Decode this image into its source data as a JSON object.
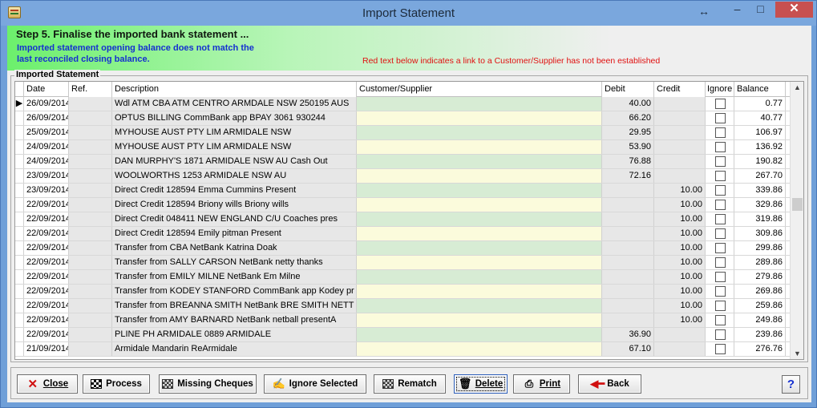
{
  "window": {
    "title": "Import Statement"
  },
  "header": {
    "step": "Step 5. Finalise the imported bank statement ...",
    "warning_line1": "Imported statement opening balance does not match the",
    "warning_line2": "last reconciled closing balance.",
    "red_info": "Red text below indicates a link to a Customer/Supplier has not been established"
  },
  "group": {
    "title": "Imported Statement"
  },
  "columns": {
    "date": "Date",
    "ref": "Ref.",
    "description": "Description",
    "customer": "Customer/Supplier",
    "debit": "Debit",
    "credit": "Credit",
    "ignore": "Ignore",
    "balance": "Balance"
  },
  "rows": [
    {
      "date": "26/09/2014",
      "ref": "",
      "description": "Wdl ATM CBA ATM  CENTRO ARMDALE NSW 250195  AUS",
      "customer": "",
      "debit": "40.00",
      "credit": "",
      "balance": "0.77",
      "cust_color": "green"
    },
    {
      "date": "26/09/2014",
      "ref": "",
      "description": "OPTUS BILLING        CommBank app BPAY 3061 930244",
      "customer": "",
      "debit": "66.20",
      "credit": "",
      "balance": "40.77",
      "cust_color": "yellow"
    },
    {
      "date": "25/09/2014",
      "ref": "",
      "description": "MYHOUSE AUST PTY LIM ARMIDALE NSW",
      "customer": "",
      "debit": "29.95",
      "credit": "",
      "balance": "106.97",
      "cust_color": "green"
    },
    {
      "date": "24/09/2014",
      "ref": "",
      "description": "MYHOUSE AUST PTY LIM ARMIDALE NSW",
      "customer": "",
      "debit": "53.90",
      "credit": "",
      "balance": "136.92",
      "cust_color": "yellow"
    },
    {
      "date": "24/09/2014",
      "ref": "",
      "description": "DAN MURPHY'S    1871 ARMIDALE NSW     AU Cash Out",
      "customer": "",
      "debit": "76.88",
      "credit": "",
      "balance": "190.82",
      "cust_color": "green"
    },
    {
      "date": "23/09/2014",
      "ref": "",
      "description": "WOOLWORTHS      1253 ARMIDALE NSW     AU",
      "customer": "",
      "debit": "72.16",
      "credit": "",
      "balance": "267.70",
      "cust_color": "yellow"
    },
    {
      "date": "23/09/2014",
      "ref": "",
      "description": "Direct Credit 128594 Emma Cummins Present",
      "customer": "",
      "debit": "",
      "credit": "10.00",
      "balance": "339.86",
      "cust_color": "green"
    },
    {
      "date": "22/09/2014",
      "ref": "",
      "description": "Direct Credit 128594 Briony wills Briony wills",
      "customer": "",
      "debit": "",
      "credit": "10.00",
      "balance": "329.86",
      "cust_color": "yellow"
    },
    {
      "date": "22/09/2014",
      "ref": "",
      "description": "Direct Credit 048411 NEW ENGLAND C/U Coaches pres",
      "customer": "",
      "debit": "",
      "credit": "10.00",
      "balance": "319.86",
      "cust_color": "green"
    },
    {
      "date": "22/09/2014",
      "ref": "",
      "description": "Direct Credit 128594 Emily pitman Present",
      "customer": "",
      "debit": "",
      "credit": "10.00",
      "balance": "309.86",
      "cust_color": "yellow"
    },
    {
      "date": "22/09/2014",
      "ref": "",
      "description": "Transfer from CBA NetBank Katrina Doak",
      "customer": "",
      "debit": "",
      "credit": "10.00",
      "balance": "299.86",
      "cust_color": "green"
    },
    {
      "date": "22/09/2014",
      "ref": "",
      "description": "Transfer from SALLY CARSON NetBank netty thanks",
      "customer": "",
      "debit": "",
      "credit": "10.00",
      "balance": "289.86",
      "cust_color": "yellow"
    },
    {
      "date": "22/09/2014",
      "ref": "",
      "description": "Transfer from EMILY MILNE NetBank Em Milne",
      "customer": "",
      "debit": "",
      "credit": "10.00",
      "balance": "279.86",
      "cust_color": "green"
    },
    {
      "date": "22/09/2014",
      "ref": "",
      "description": "Transfer from KODEY STANFORD CommBank app Kodey pr",
      "customer": "",
      "debit": "",
      "credit": "10.00",
      "balance": "269.86",
      "cust_color": "yellow"
    },
    {
      "date": "22/09/2014",
      "ref": "",
      "description": "Transfer from BREANNA SMITH NetBank BRE SMITH NETT",
      "customer": "",
      "debit": "",
      "credit": "10.00",
      "balance": "259.86",
      "cust_color": "green"
    },
    {
      "date": "22/09/2014",
      "ref": "",
      "description": "Transfer from AMY BARNARD NetBank netball presentA",
      "customer": "",
      "debit": "",
      "credit": "10.00",
      "balance": "249.86",
      "cust_color": "yellow"
    },
    {
      "date": "22/09/2014",
      "ref": "",
      "description": "PLINE PH ARMIDALE   0889 ARMIDALE",
      "customer": "",
      "debit": "36.90",
      "credit": "",
      "balance": "239.86",
      "cust_color": "green"
    },
    {
      "date": "21/09/2014",
      "ref": "",
      "description": "Armidale Mandarin ReArmidale",
      "customer": "",
      "debit": "67.10",
      "credit": "",
      "balance": "276.76",
      "cust_color": "yellow"
    }
  ],
  "buttons": {
    "close": "Close",
    "process": "Process",
    "missing_cheques": "Missing Cheques",
    "ignore_selected": "Ignore Selected",
    "rematch": "Rematch",
    "delete": "Delete",
    "print": "Print",
    "back": "Back",
    "help": "?"
  },
  "icons": {
    "close": "red-x-icon",
    "process": "checkered-flag-icon",
    "missing": "cheque-icon",
    "ignore": "ignore-icon",
    "rematch": "rematch-icon",
    "delete": "trash-icon",
    "print": "printer-icon",
    "back": "back-arrow-icon"
  },
  "colors": {
    "header_green": "#6cf06c",
    "warning_blue": "#1530d0",
    "info_red": "#e01010",
    "cust_green": "#d7ecd4",
    "cust_yellow": "#fbfbdc"
  }
}
